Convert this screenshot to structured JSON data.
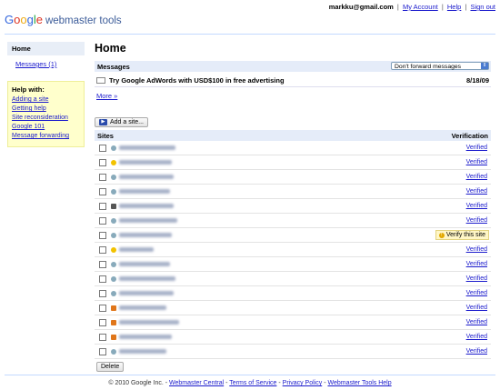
{
  "topbar": {
    "email": "markku@gmail.com",
    "links": [
      "My Account",
      "Help",
      "Sign out"
    ]
  },
  "logo": {
    "brand": "Google",
    "product": "webmaster tools"
  },
  "sidebar": {
    "home_label": "Home",
    "messages_label": "Messages (1)",
    "help_title": "Help with:",
    "help_links": [
      "Adding a site",
      "Getting help",
      "Site reconsideration",
      "Google 101",
      "Message forwarding"
    ]
  },
  "main": {
    "title": "Home",
    "messages_header": "Messages",
    "forward_select": "Don't forward messages",
    "message": {
      "subject": "Try Google AdWords with USD$100 in free advertising",
      "date": "8/18/09"
    },
    "more_link": "More »",
    "add_site_label": "Add a site...",
    "sites_col": "Sites",
    "verification_col": "Verification",
    "delete_label": "Delete",
    "verify_label": "Verify this site",
    "sites": [
      {
        "status": "Verified",
        "icon": "globe",
        "color": "#8ab"
      },
      {
        "status": "Verified",
        "icon": "bulb",
        "color": "#f2c200"
      },
      {
        "status": "Verified",
        "icon": "globe",
        "color": "#8ab"
      },
      {
        "status": "Verified",
        "icon": "globe",
        "color": "#8ab"
      },
      {
        "status": "Verified",
        "icon": "camera",
        "color": "#555"
      },
      {
        "status": "Verified",
        "icon": "globe",
        "color": "#8ab"
      },
      {
        "status": "unverified",
        "icon": "globe",
        "color": "#8ab"
      },
      {
        "status": "Verified",
        "icon": "bulb",
        "color": "#f2c200"
      },
      {
        "status": "Verified",
        "icon": "globe",
        "color": "#8ab"
      },
      {
        "status": "Verified",
        "icon": "globe",
        "color": "#8ab"
      },
      {
        "status": "Verified",
        "icon": "globe",
        "color": "#8ab"
      },
      {
        "status": "Verified",
        "icon": "blogger",
        "color": "#e0761a"
      },
      {
        "status": "Verified",
        "icon": "blogger",
        "color": "#e0761a"
      },
      {
        "status": "Verified",
        "icon": "blogger",
        "color": "#e0761a"
      },
      {
        "status": "Verified",
        "icon": "globe",
        "color": "#8ab"
      }
    ]
  },
  "footer": {
    "copyright": "© 2010 Google Inc.",
    "links": [
      "Webmaster Central",
      "Terms of Service",
      "Privacy Policy",
      "Webmaster Tools Help"
    ]
  }
}
